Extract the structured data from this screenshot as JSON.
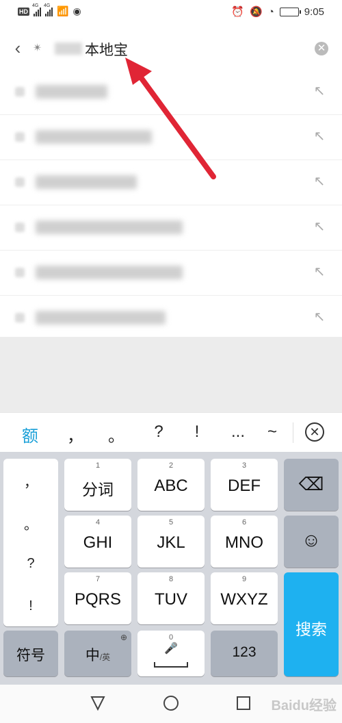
{
  "status_bar": {
    "hd_badge": "HD",
    "net1": "4G",
    "net2": "4G",
    "battery_label": "",
    "time": "9:05"
  },
  "search": {
    "query_visible": "本地宝",
    "back_icon": "chevron-left-icon",
    "clear_icon": "clear-circle-icon"
  },
  "suggestions": [
    {
      "fill_icon": "arrow-up-left-icon"
    },
    {
      "fill_icon": "arrow-up-left-icon"
    },
    {
      "fill_icon": "arrow-up-left-icon"
    },
    {
      "fill_icon": "arrow-up-left-icon"
    },
    {
      "fill_icon": "arrow-up-left-icon"
    },
    {
      "fill_icon": "arrow-up-left-icon"
    }
  ],
  "candidates": [
    "额",
    "，",
    "。",
    "?",
    "!",
    "...",
    "~"
  ],
  "keyboard": {
    "punct_column": [
      "，",
      "。",
      "?",
      "!"
    ],
    "keys": {
      "k1": {
        "num": "1",
        "label": "分词"
      },
      "k2": {
        "num": "2",
        "label": "ABC"
      },
      "k3": {
        "num": "3",
        "label": "DEF"
      },
      "k4": {
        "num": "4",
        "label": "GHI"
      },
      "k5": {
        "num": "5",
        "label": "JKL"
      },
      "k6": {
        "num": "6",
        "label": "MNO"
      },
      "k7": {
        "num": "7",
        "label": "PQRS"
      },
      "k8": {
        "num": "8",
        "label": "TUV"
      },
      "k9": {
        "num": "9",
        "label": "WXYZ"
      },
      "k0": {
        "num": "0"
      }
    },
    "symbols_label": "符号",
    "lang_main": "中",
    "lang_sub": "/英",
    "num_label": "123",
    "search_label": "搜索"
  },
  "watermark": "Baidu经验",
  "colors": {
    "accent": "#1eb1f0",
    "candidate_highlight": "#1aa0d8",
    "annotation_arrow": "#e02535"
  }
}
